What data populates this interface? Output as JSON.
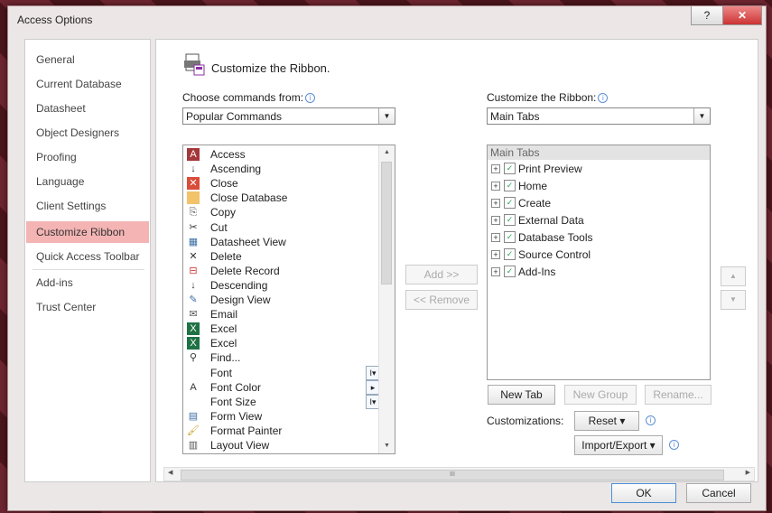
{
  "window": {
    "title": "Access Options",
    "help_label": "?",
    "close_label": "✕"
  },
  "nav": {
    "items": [
      {
        "label": "General"
      },
      {
        "label": "Current Database"
      },
      {
        "label": "Datasheet"
      },
      {
        "label": "Object Designers"
      },
      {
        "label": "Proofing"
      },
      {
        "label": "Language"
      },
      {
        "label": "Client Settings"
      },
      {
        "label": "Customize Ribbon",
        "selected": true
      },
      {
        "label": "Quick Access Toolbar"
      },
      {
        "label": "Add-ins"
      },
      {
        "label": "Trust Center"
      }
    ]
  },
  "header": {
    "title": "Customize the Ribbon."
  },
  "left": {
    "choose_label": "Choose commands from:",
    "choose_value": "Popular Commands",
    "commands": [
      {
        "label": "Access",
        "icon": "access-icon"
      },
      {
        "label": "Ascending",
        "icon": "sort-ascending-icon"
      },
      {
        "label": "Close",
        "icon": "close-icon"
      },
      {
        "label": "Close Database",
        "icon": "folder-icon"
      },
      {
        "label": "Copy",
        "icon": "copy-icon"
      },
      {
        "label": "Cut",
        "icon": "scissors-icon"
      },
      {
        "label": "Datasheet View",
        "icon": "datasheet-icon"
      },
      {
        "label": "Delete",
        "icon": "delete-x-icon"
      },
      {
        "label": "Delete Record",
        "icon": "delete-record-icon"
      },
      {
        "label": "Descending",
        "icon": "sort-descending-icon"
      },
      {
        "label": "Design View",
        "icon": "design-view-icon"
      },
      {
        "label": "Email",
        "icon": "email-icon"
      },
      {
        "label": "Excel",
        "icon": "excel-icon"
      },
      {
        "label": "Excel",
        "icon": "excel-icon"
      },
      {
        "label": "Find...",
        "icon": "binoculars-icon"
      },
      {
        "label": "Font",
        "icon": "blank-icon",
        "sub": "I▾"
      },
      {
        "label": "Font Color",
        "icon": "font-color-icon",
        "sub": "▸"
      },
      {
        "label": "Font Size",
        "icon": "blank-icon",
        "sub": "I▾"
      },
      {
        "label": "Form View",
        "icon": "form-view-icon"
      },
      {
        "label": "Format Painter",
        "icon": "format-painter-icon"
      },
      {
        "label": "Layout View",
        "icon": "layout-view-icon"
      }
    ]
  },
  "middle": {
    "add_label": "Add >>",
    "remove_label": "<< Remove"
  },
  "right": {
    "customize_label": "Customize the Ribbon:",
    "customize_value": "Main Tabs",
    "tree_header": "Main Tabs",
    "tabs": [
      {
        "label": "Print Preview"
      },
      {
        "label": "Home"
      },
      {
        "label": "Create"
      },
      {
        "label": "External Data"
      },
      {
        "label": "Database Tools"
      },
      {
        "label": "Source Control"
      },
      {
        "label": "Add-Ins"
      }
    ],
    "new_tab": "New Tab",
    "new_group": "New Group",
    "rename": "Rename...",
    "customizations_label": "Customizations:",
    "reset": "Reset ▾",
    "import_export": "Import/Export ▾"
  },
  "footer": {
    "ok": "OK",
    "cancel": "Cancel"
  },
  "scroll": {
    "grip": "III"
  }
}
